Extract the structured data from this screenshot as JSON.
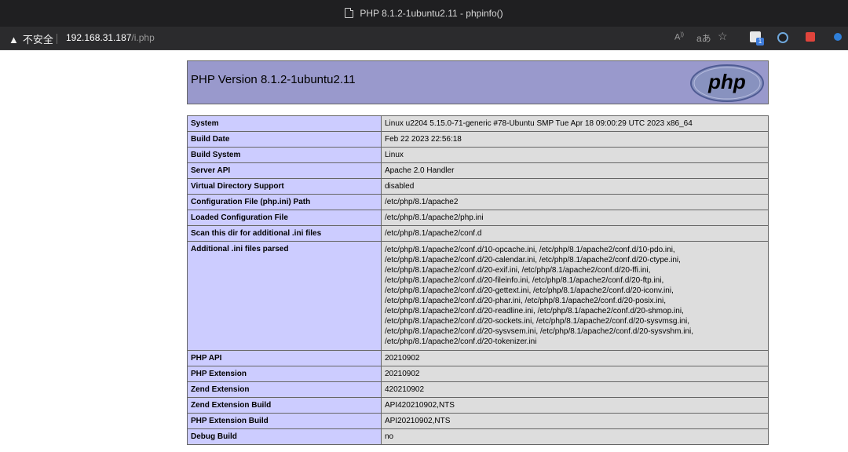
{
  "window": {
    "title": "PHP 8.1.2-1ubuntu2.11 - phpinfo()"
  },
  "address_bar": {
    "security_label": "不安全",
    "host": "192.168.31.187",
    "path": "/i.php",
    "icons": [
      "read-aloud-icon",
      "translate-icon",
      "favorite-icon",
      "extension-icon",
      "circle-extension-icon",
      "red-extension-icon",
      "edge-icon"
    ],
    "extension_badge": "1"
  },
  "header": {
    "title": "PHP Version 8.1.2-1ubuntu2.11",
    "logo_text": "php"
  },
  "rows": [
    {
      "name": "System",
      "value": "Linux u2204 5.15.0-71-generic #78-Ubuntu SMP Tue Apr 18 09:00:29 UTC 2023 x86_64"
    },
    {
      "name": "Build Date",
      "value": "Feb 22 2023 22:56:18"
    },
    {
      "name": "Build System",
      "value": "Linux"
    },
    {
      "name": "Server API",
      "value": "Apache 2.0 Handler"
    },
    {
      "name": "Virtual Directory Support",
      "value": "disabled"
    },
    {
      "name": "Configuration File (php.ini) Path",
      "value": "/etc/php/8.1/apache2"
    },
    {
      "name": "Loaded Configuration File",
      "value": "/etc/php/8.1/apache2/php.ini"
    },
    {
      "name": "Scan this dir for additional .ini files",
      "value": "/etc/php/8.1/apache2/conf.d"
    }
  ],
  "ini_parsed": {
    "name": "Additional .ini files parsed",
    "lines": [
      "/etc/php/8.1/apache2/conf.d/10-opcache.ini, /etc/php/8.1/apache2/conf.d/10-pdo.ini,",
      "/etc/php/8.1/apache2/conf.d/20-calendar.ini, /etc/php/8.1/apache2/conf.d/20-ctype.ini,",
      "/etc/php/8.1/apache2/conf.d/20-exif.ini, /etc/php/8.1/apache2/conf.d/20-ffi.ini,",
      "/etc/php/8.1/apache2/conf.d/20-fileinfo.ini, /etc/php/8.1/apache2/conf.d/20-ftp.ini,",
      "/etc/php/8.1/apache2/conf.d/20-gettext.ini, /etc/php/8.1/apache2/conf.d/20-iconv.ini,",
      "/etc/php/8.1/apache2/conf.d/20-phar.ini, /etc/php/8.1/apache2/conf.d/20-posix.ini,",
      "/etc/php/8.1/apache2/conf.d/20-readline.ini, /etc/php/8.1/apache2/conf.d/20-shmop.ini,",
      "/etc/php/8.1/apache2/conf.d/20-sockets.ini, /etc/php/8.1/apache2/conf.d/20-sysvmsg.ini,",
      "/etc/php/8.1/apache2/conf.d/20-sysvsem.ini, /etc/php/8.1/apache2/conf.d/20-sysvshm.ini,",
      "/etc/php/8.1/apache2/conf.d/20-tokenizer.ini"
    ]
  },
  "rows2": [
    {
      "name": "PHP API",
      "value": "20210902"
    },
    {
      "name": "PHP Extension",
      "value": "20210902"
    },
    {
      "name": "Zend Extension",
      "value": "420210902"
    },
    {
      "name": "Zend Extension Build",
      "value": "API420210902,NTS"
    },
    {
      "name": "PHP Extension Build",
      "value": "API20210902,NTS"
    },
    {
      "name": "Debug Build",
      "value": "no"
    }
  ],
  "colors": {
    "header_bg": "#9999cc",
    "key_bg": "#ccccff",
    "value_bg": "#dddddd",
    "logo_bg": "#8892bf"
  }
}
